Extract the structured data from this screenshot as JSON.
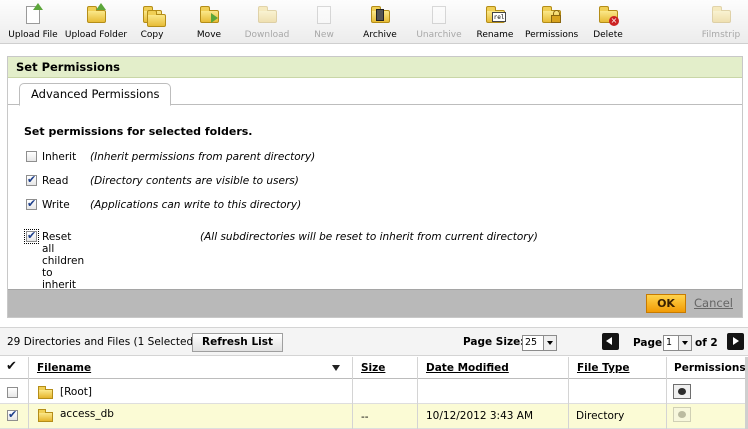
{
  "toolbar": {
    "items": [
      {
        "label": "Upload File",
        "icon": "upload-file-icon",
        "enabled": true
      },
      {
        "label": "Upload Folder",
        "icon": "upload-folder-icon",
        "enabled": true
      },
      {
        "label": "Copy",
        "icon": "copy-icon",
        "enabled": true
      },
      {
        "label": "Move",
        "icon": "move-icon",
        "enabled": true
      },
      {
        "label": "Download",
        "icon": "download-icon",
        "enabled": false
      },
      {
        "label": "New",
        "icon": "new-icon",
        "enabled": false
      },
      {
        "label": "Archive",
        "icon": "archive-icon",
        "enabled": true
      },
      {
        "label": "Unarchive",
        "icon": "unarchive-icon",
        "enabled": false
      },
      {
        "label": "Rename",
        "icon": "rename-icon",
        "enabled": true
      },
      {
        "label": "Permissions",
        "icon": "permissions-icon",
        "enabled": true
      },
      {
        "label": "Delete",
        "icon": "delete-icon",
        "enabled": true
      },
      {
        "label": "Filmstrip",
        "icon": "filmstrip-icon",
        "enabled": false
      }
    ]
  },
  "permissions_panel": {
    "title": "Set Permissions",
    "tab": "Advanced Permissions",
    "heading": "Set permissions for selected folders.",
    "options": [
      {
        "label": "Inherit",
        "description": "(Inherit permissions from parent directory)",
        "checked": false
      },
      {
        "label": "Read",
        "description": "(Directory contents are visible to users)",
        "checked": true
      },
      {
        "label": "Write",
        "description": "(Applications can write to this directory)",
        "checked": true
      },
      {
        "label": "Reset all children to inherit",
        "description": "(All subdirectories will be reset to inherit from current directory)",
        "checked": true
      }
    ],
    "ok_label": "OK",
    "cancel_label": "Cancel"
  },
  "list_bar": {
    "count_text": "29 Directories and Files (1 Selected)",
    "refresh_label": "Refresh List",
    "page_size_label": "Page Size:",
    "page_size_value": "25",
    "page_label": "Page",
    "page_value": "1",
    "of_label": "of 2"
  },
  "table": {
    "columns": {
      "filename": "Filename",
      "size": "Size",
      "date_modified": "Date Modified",
      "file_type": "File Type",
      "permissions": "Permissions"
    },
    "rows": [
      {
        "name": "[Root]",
        "size": "",
        "date": "",
        "type": "",
        "checked": false,
        "selected": false
      },
      {
        "name": "access_db",
        "size": "--",
        "date": "10/12/2012 3:43 AM",
        "type": "Directory",
        "checked": true,
        "selected": true
      }
    ]
  }
}
